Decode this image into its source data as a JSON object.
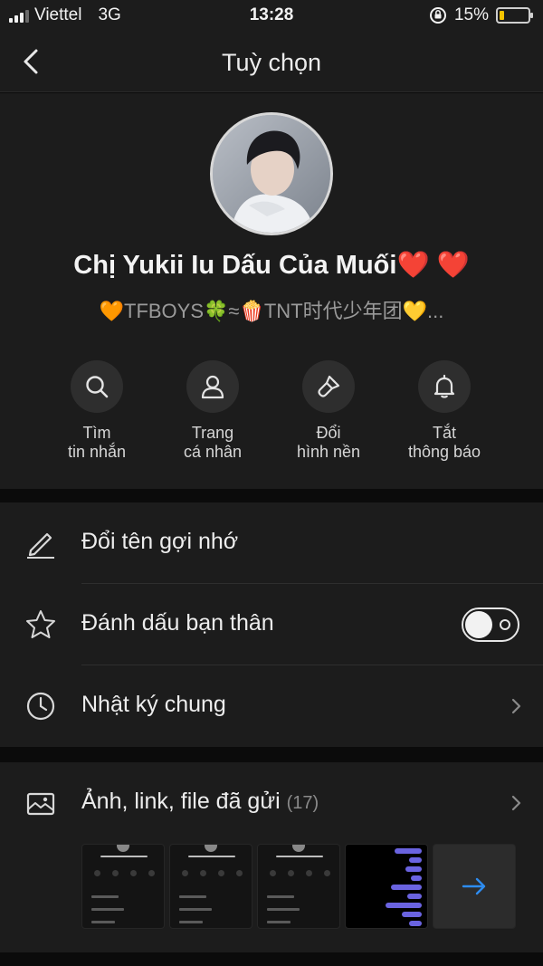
{
  "status_bar": {
    "carrier": "Viettel",
    "network": "3G",
    "time": "13:28",
    "battery_percent": "15%",
    "battery_level": 0.15
  },
  "nav": {
    "title": "Tuỳ chọn"
  },
  "profile": {
    "name": "Chị Yukii Iu Dấu Của Muối❤️ ❤️",
    "bio": "🧡TFBOYS🍀≈🍿TNT时代少年团💛..."
  },
  "actions": [
    {
      "label": "Tìm\ntin nhắn",
      "icon": "search-icon"
    },
    {
      "label": "Trang\ncá nhân",
      "icon": "person-icon"
    },
    {
      "label": "Đổi\nhình nền",
      "icon": "paintbrush-icon"
    },
    {
      "label": "Tắt\nthông báo",
      "icon": "bell-icon"
    }
  ],
  "settings": {
    "rename": {
      "label": "Đổi tên gợi nhớ",
      "icon": "pencil-icon"
    },
    "best_friend": {
      "label": "Đánh dấu bạn thân",
      "icon": "star-icon",
      "toggle_on": false
    },
    "diary": {
      "label": "Nhật ký chung",
      "icon": "clock-icon"
    }
  },
  "media": {
    "label": "Ảnh, link, file đã gửi",
    "count": "(17)",
    "icon": "gallery-icon",
    "more_icon": "arrow-right-icon"
  },
  "colors": {
    "accent": "#2d8cf0",
    "background": "#1c1c1c",
    "battery": "#f5c400"
  }
}
